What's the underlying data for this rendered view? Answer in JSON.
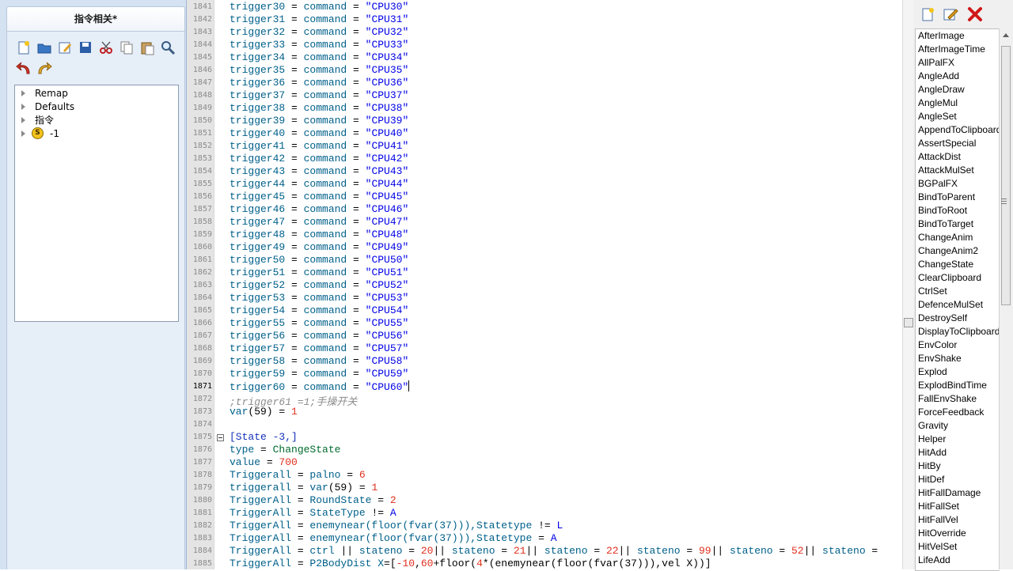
{
  "left_panel": {
    "title": "指令相关*",
    "toolbar_icons": [
      "new-file-icon",
      "open-folder-icon",
      "edit-icon",
      "save-icon",
      "cut-icon",
      "copy-icon",
      "paste-icon",
      "search-icon",
      "undo-icon",
      "redo-icon"
    ],
    "tree": [
      {
        "label": "Remap",
        "badge": ""
      },
      {
        "label": "Defaults",
        "badge": ""
      },
      {
        "label": "指令",
        "badge": ""
      },
      {
        "label": "-1",
        "badge": "S"
      }
    ]
  },
  "editor": {
    "current_line": "1871",
    "lines": [
      {
        "n": "1841",
        "t": [
          [
            "kw",
            "trigger30"
          ],
          [
            "op",
            " = "
          ],
          [
            "kw",
            "command"
          ],
          [
            "op",
            " = "
          ],
          [
            "str",
            "\"CPU30\""
          ]
        ]
      },
      {
        "n": "1842",
        "t": [
          [
            "kw",
            "trigger31"
          ],
          [
            "op",
            " = "
          ],
          [
            "kw",
            "command"
          ],
          [
            "op",
            " = "
          ],
          [
            "str",
            "\"CPU31\""
          ]
        ]
      },
      {
        "n": "1843",
        "t": [
          [
            "kw",
            "trigger32"
          ],
          [
            "op",
            " = "
          ],
          [
            "kw",
            "command"
          ],
          [
            "op",
            " = "
          ],
          [
            "str",
            "\"CPU32\""
          ]
        ]
      },
      {
        "n": "1844",
        "t": [
          [
            "kw",
            "trigger33"
          ],
          [
            "op",
            " = "
          ],
          [
            "kw",
            "command"
          ],
          [
            "op",
            " = "
          ],
          [
            "str",
            "\"CPU33\""
          ]
        ]
      },
      {
        "n": "1845",
        "t": [
          [
            "kw",
            "trigger34"
          ],
          [
            "op",
            " = "
          ],
          [
            "kw",
            "command"
          ],
          [
            "op",
            " = "
          ],
          [
            "str",
            "\"CPU34\""
          ]
        ]
      },
      {
        "n": "1846",
        "t": [
          [
            "kw",
            "trigger35"
          ],
          [
            "op",
            " = "
          ],
          [
            "kw",
            "command"
          ],
          [
            "op",
            " = "
          ],
          [
            "str",
            "\"CPU35\""
          ]
        ]
      },
      {
        "n": "1847",
        "t": [
          [
            "kw",
            "trigger36"
          ],
          [
            "op",
            " = "
          ],
          [
            "kw",
            "command"
          ],
          [
            "op",
            " = "
          ],
          [
            "str",
            "\"CPU36\""
          ]
        ]
      },
      {
        "n": "1848",
        "t": [
          [
            "kw",
            "trigger37"
          ],
          [
            "op",
            " = "
          ],
          [
            "kw",
            "command"
          ],
          [
            "op",
            " = "
          ],
          [
            "str",
            "\"CPU37\""
          ]
        ]
      },
      {
        "n": "1849",
        "t": [
          [
            "kw",
            "trigger38"
          ],
          [
            "op",
            " = "
          ],
          [
            "kw",
            "command"
          ],
          [
            "op",
            " = "
          ],
          [
            "str",
            "\"CPU38\""
          ]
        ]
      },
      {
        "n": "1850",
        "t": [
          [
            "kw",
            "trigger39"
          ],
          [
            "op",
            " = "
          ],
          [
            "kw",
            "command"
          ],
          [
            "op",
            " = "
          ],
          [
            "str",
            "\"CPU39\""
          ]
        ]
      },
      {
        "n": "1851",
        "t": [
          [
            "kw",
            "trigger40"
          ],
          [
            "op",
            " = "
          ],
          [
            "kw",
            "command"
          ],
          [
            "op",
            " = "
          ],
          [
            "str",
            "\"CPU40\""
          ]
        ]
      },
      {
        "n": "1852",
        "t": [
          [
            "kw",
            "trigger41"
          ],
          [
            "op",
            " = "
          ],
          [
            "kw",
            "command"
          ],
          [
            "op",
            " = "
          ],
          [
            "str",
            "\"CPU41\""
          ]
        ]
      },
      {
        "n": "1853",
        "t": [
          [
            "kw",
            "trigger42"
          ],
          [
            "op",
            " = "
          ],
          [
            "kw",
            "command"
          ],
          [
            "op",
            " = "
          ],
          [
            "str",
            "\"CPU42\""
          ]
        ]
      },
      {
        "n": "1854",
        "t": [
          [
            "kw",
            "trigger43"
          ],
          [
            "op",
            " = "
          ],
          [
            "kw",
            "command"
          ],
          [
            "op",
            " = "
          ],
          [
            "str",
            "\"CPU43\""
          ]
        ]
      },
      {
        "n": "1855",
        "t": [
          [
            "kw",
            "trigger44"
          ],
          [
            "op",
            " = "
          ],
          [
            "kw",
            "command"
          ],
          [
            "op",
            " = "
          ],
          [
            "str",
            "\"CPU44\""
          ]
        ]
      },
      {
        "n": "1856",
        "t": [
          [
            "kw",
            "trigger45"
          ],
          [
            "op",
            " = "
          ],
          [
            "kw",
            "command"
          ],
          [
            "op",
            " = "
          ],
          [
            "str",
            "\"CPU45\""
          ]
        ]
      },
      {
        "n": "1857",
        "t": [
          [
            "kw",
            "trigger46"
          ],
          [
            "op",
            " = "
          ],
          [
            "kw",
            "command"
          ],
          [
            "op",
            " = "
          ],
          [
            "str",
            "\"CPU46\""
          ]
        ]
      },
      {
        "n": "1858",
        "t": [
          [
            "kw",
            "trigger47"
          ],
          [
            "op",
            " = "
          ],
          [
            "kw",
            "command"
          ],
          [
            "op",
            " = "
          ],
          [
            "str",
            "\"CPU47\""
          ]
        ]
      },
      {
        "n": "1859",
        "t": [
          [
            "kw",
            "trigger48"
          ],
          [
            "op",
            " = "
          ],
          [
            "kw",
            "command"
          ],
          [
            "op",
            " = "
          ],
          [
            "str",
            "\"CPU48\""
          ]
        ]
      },
      {
        "n": "1860",
        "t": [
          [
            "kw",
            "trigger49"
          ],
          [
            "op",
            " = "
          ],
          [
            "kw",
            "command"
          ],
          [
            "op",
            " = "
          ],
          [
            "str",
            "\"CPU49\""
          ]
        ]
      },
      {
        "n": "1861",
        "t": [
          [
            "kw",
            "trigger50"
          ],
          [
            "op",
            " = "
          ],
          [
            "kw",
            "command"
          ],
          [
            "op",
            " = "
          ],
          [
            "str",
            "\"CPU50\""
          ]
        ]
      },
      {
        "n": "1862",
        "t": [
          [
            "kw",
            "trigger51"
          ],
          [
            "op",
            " = "
          ],
          [
            "kw",
            "command"
          ],
          [
            "op",
            " = "
          ],
          [
            "str",
            "\"CPU51\""
          ]
        ]
      },
      {
        "n": "1863",
        "t": [
          [
            "kw",
            "trigger52"
          ],
          [
            "op",
            " = "
          ],
          [
            "kw",
            "command"
          ],
          [
            "op",
            " = "
          ],
          [
            "str",
            "\"CPU52\""
          ]
        ]
      },
      {
        "n": "1864",
        "t": [
          [
            "kw",
            "trigger53"
          ],
          [
            "op",
            " = "
          ],
          [
            "kw",
            "command"
          ],
          [
            "op",
            " = "
          ],
          [
            "str",
            "\"CPU53\""
          ]
        ]
      },
      {
        "n": "1865",
        "t": [
          [
            "kw",
            "trigger54"
          ],
          [
            "op",
            " = "
          ],
          [
            "kw",
            "command"
          ],
          [
            "op",
            " = "
          ],
          [
            "str",
            "\"CPU54\""
          ]
        ]
      },
      {
        "n": "1866",
        "t": [
          [
            "kw",
            "trigger55"
          ],
          [
            "op",
            " = "
          ],
          [
            "kw",
            "command"
          ],
          [
            "op",
            " = "
          ],
          [
            "str",
            "\"CPU55\""
          ]
        ]
      },
      {
        "n": "1867",
        "t": [
          [
            "kw",
            "trigger56"
          ],
          [
            "op",
            " = "
          ],
          [
            "kw",
            "command"
          ],
          [
            "op",
            " = "
          ],
          [
            "str",
            "\"CPU56\""
          ]
        ]
      },
      {
        "n": "1868",
        "t": [
          [
            "kw",
            "trigger57"
          ],
          [
            "op",
            " = "
          ],
          [
            "kw",
            "command"
          ],
          [
            "op",
            " = "
          ],
          [
            "str",
            "\"CPU57\""
          ]
        ]
      },
      {
        "n": "1869",
        "t": [
          [
            "kw",
            "trigger58"
          ],
          [
            "op",
            " = "
          ],
          [
            "kw",
            "command"
          ],
          [
            "op",
            " = "
          ],
          [
            "str",
            "\"CPU58\""
          ]
        ]
      },
      {
        "n": "1870",
        "t": [
          [
            "kw",
            "trigger59"
          ],
          [
            "op",
            " = "
          ],
          [
            "kw",
            "command"
          ],
          [
            "op",
            " = "
          ],
          [
            "str",
            "\"CPU59\""
          ]
        ]
      },
      {
        "n": "1871",
        "t": [
          [
            "kw",
            "trigger60"
          ],
          [
            "op",
            " = "
          ],
          [
            "kw",
            "command"
          ],
          [
            "op",
            " = "
          ],
          [
            "str",
            "\"CPU60\""
          ]
        ],
        "caret": true
      },
      {
        "n": "1872",
        "t": [
          [
            "cmt",
            ";trigger61 =1;手操开关"
          ]
        ]
      },
      {
        "n": "1873",
        "t": [
          [
            "kw",
            "var"
          ],
          [
            "op",
            "(59) = "
          ],
          [
            "num",
            "1"
          ]
        ]
      },
      {
        "n": "1874",
        "t": []
      },
      {
        "n": "1875",
        "t": [
          [
            "sect",
            "[State -3,]"
          ]
        ],
        "fold": true
      },
      {
        "n": "1876",
        "t": [
          [
            "kw",
            "type"
          ],
          [
            "op",
            " = "
          ],
          [
            "ctrl",
            "ChangeState"
          ]
        ]
      },
      {
        "n": "1877",
        "t": [
          [
            "kw",
            "value"
          ],
          [
            "op",
            " = "
          ],
          [
            "num",
            "700"
          ]
        ]
      },
      {
        "n": "1878",
        "t": [
          [
            "kw",
            "Triggerall"
          ],
          [
            "op",
            " = "
          ],
          [
            "kw",
            "palno"
          ],
          [
            "op",
            " = "
          ],
          [
            "num",
            "6"
          ]
        ]
      },
      {
        "n": "1879",
        "t": [
          [
            "kw",
            "triggerall"
          ],
          [
            "op",
            " = "
          ],
          [
            "kw",
            "var"
          ],
          [
            "op",
            "(59) = "
          ],
          [
            "num",
            "1"
          ]
        ]
      },
      {
        "n": "1880",
        "t": [
          [
            "kw",
            "TriggerAll"
          ],
          [
            "op",
            " = "
          ],
          [
            "kw",
            "RoundState"
          ],
          [
            "op",
            " = "
          ],
          [
            "num",
            "2"
          ]
        ]
      },
      {
        "n": "1881",
        "t": [
          [
            "kw",
            "TriggerAll"
          ],
          [
            "op",
            " = "
          ],
          [
            "kw",
            "StateType"
          ],
          [
            "op",
            " != "
          ],
          [
            "str",
            "A"
          ]
        ]
      },
      {
        "n": "1882",
        "t": [
          [
            "kw",
            "TriggerAll"
          ],
          [
            "op",
            " = "
          ],
          [
            "kw",
            "enemynear(floor(fvar(37))),Statetype"
          ],
          [
            "op",
            " != "
          ],
          [
            "str",
            "L"
          ]
        ]
      },
      {
        "n": "1883",
        "t": [
          [
            "kw",
            "TriggerAll"
          ],
          [
            "op",
            " = "
          ],
          [
            "kw",
            "enemynear(floor(fvar(37))),Statetype"
          ],
          [
            "op",
            " = "
          ],
          [
            "str",
            "A"
          ]
        ]
      },
      {
        "n": "1884",
        "t": [
          [
            "kw",
            "TriggerAll"
          ],
          [
            "op",
            " = "
          ],
          [
            "kw",
            "ctrl"
          ],
          [
            "op",
            " || "
          ],
          [
            "kw",
            "stateno"
          ],
          [
            "op",
            " = "
          ],
          [
            "num",
            "20"
          ],
          [
            "op",
            "|| "
          ],
          [
            "kw",
            "stateno"
          ],
          [
            "op",
            " = "
          ],
          [
            "num",
            "21"
          ],
          [
            "op",
            "|| "
          ],
          [
            "kw",
            "stateno"
          ],
          [
            "op",
            " = "
          ],
          [
            "num",
            "22"
          ],
          [
            "op",
            "|| "
          ],
          [
            "kw",
            "stateno"
          ],
          [
            "op",
            " = "
          ],
          [
            "num",
            "99"
          ],
          [
            "op",
            "|| "
          ],
          [
            "kw",
            "stateno"
          ],
          [
            "op",
            " = "
          ],
          [
            "num",
            "52"
          ],
          [
            "op",
            "|| "
          ],
          [
            "kw",
            "stateno"
          ],
          [
            "op",
            " ="
          ]
        ]
      },
      {
        "n": "1885",
        "t": [
          [
            "kw",
            "TriggerAll"
          ],
          [
            "op",
            " = "
          ],
          [
            "kw",
            "P2BodyDist X"
          ],
          [
            "op",
            "=["
          ],
          [
            "num",
            "-10"
          ],
          [
            "op",
            ","
          ],
          [
            "num",
            "60"
          ],
          [
            "op",
            "+floor("
          ],
          [
            "num",
            "4"
          ],
          [
            "op",
            "*(enemynear(floor(fvar(37))),vel X))]"
          ]
        ]
      }
    ]
  },
  "right_panel": {
    "toolbar_icons": [
      "new-item-icon",
      "edit-item-icon",
      "delete-icon"
    ],
    "controllers": [
      "AfterImage",
      "AfterImageTime",
      "AllPalFX",
      "AngleAdd",
      "AngleDraw",
      "AngleMul",
      "AngleSet",
      "AppendToClipboard",
      "AssertSpecial",
      "AttackDist",
      "AttackMulSet",
      "BGPalFX",
      "BindToParent",
      "BindToRoot",
      "BindToTarget",
      "ChangeAnim",
      "ChangeAnim2",
      "ChangeState",
      "ClearClipboard",
      "CtrlSet",
      "DefenceMulSet",
      "DestroySelf",
      "DisplayToClipboard",
      "EnvColor",
      "EnvShake",
      "Explod",
      "ExplodBindTime",
      "FallEnvShake",
      "ForceFeedback",
      "Gravity",
      "Helper",
      "HitAdd",
      "HitBy",
      "HitDef",
      "HitFallDamage",
      "HitFallSet",
      "HitFallVel",
      "HitOverride",
      "HitVelSet",
      "LifeAdd"
    ]
  }
}
